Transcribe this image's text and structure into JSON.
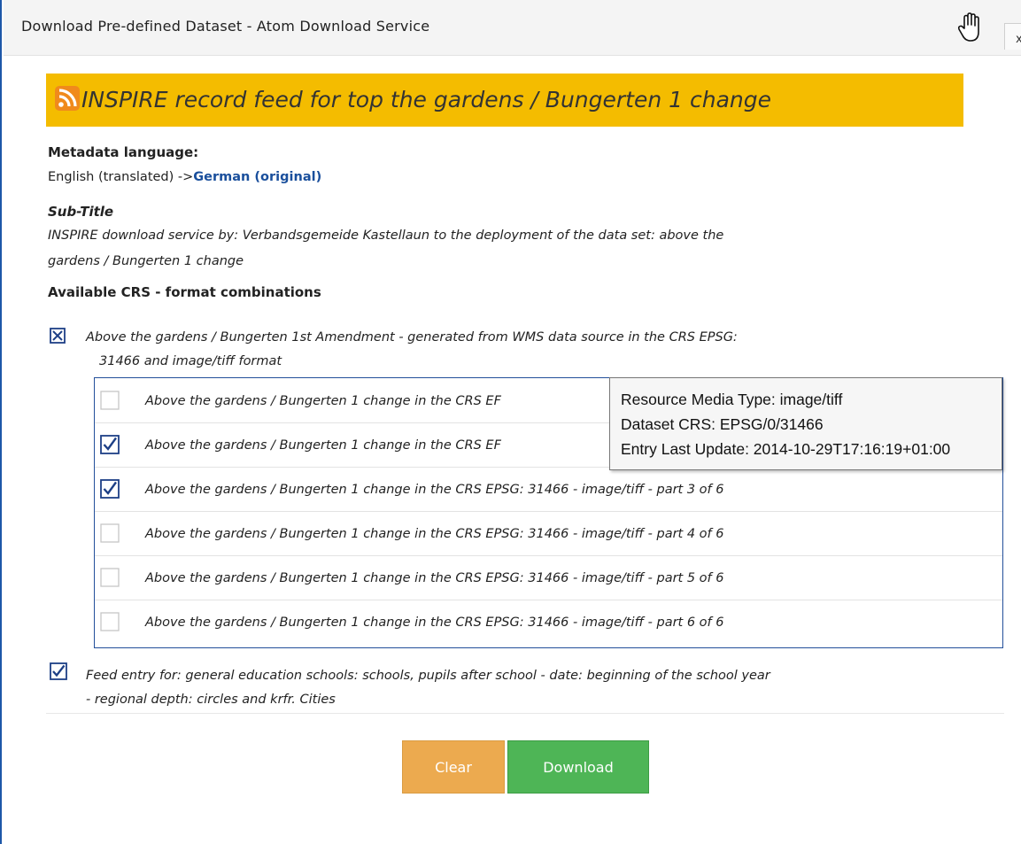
{
  "dialog": {
    "title": "Download Pre-defined Dataset - Atom Download Service",
    "close_label": "x"
  },
  "header": {
    "title": "INSPIRE record feed for top the gardens / Bungerten 1 change",
    "accent_color": "#f4bc00"
  },
  "metadata": {
    "language_label": "Metadata language:",
    "language_current": "English (translated) ->",
    "language_link": "German (original)"
  },
  "subtitle": {
    "label": "Sub-Title",
    "line1": "INSPIRE download service by: Verbandsgemeide Kastellaun to the deployment of the data set: above the",
    "line2": "gardens / Bungerten 1 change"
  },
  "crs": {
    "label": "Available CRS - format combinations",
    "main_entry": {
      "line1": "Above the gardens / Bungerten 1st Amendment - generated from WMS data source in the CRS EPSG:",
      "line2": "31466 and image/tiff format",
      "state": "partial"
    },
    "parts": [
      {
        "label": "Above the gardens / Bungerten 1 change in the CRS EF",
        "checked": false
      },
      {
        "label": "Above the gardens / Bungerten 1 change in the CRS EF",
        "checked": true
      },
      {
        "label": "Above the gardens / Bungerten 1 change in the CRS EPSG: 31466 - image/tiff - part 3 of 6",
        "checked": true
      },
      {
        "label": "Above the gardens / Bungerten 1 change in the CRS EPSG: 31466 - image/tiff - part 4 of 6",
        "checked": false
      },
      {
        "label": "Above the gardens / Bungerten 1 change in the CRS EPSG: 31466 - image/tiff - part 5 of 6",
        "checked": false
      },
      {
        "label": "Above the gardens / Bungerten 1 change in the CRS EPSG: 31466 - image/tiff - part 6 of 6",
        "checked": false
      }
    ],
    "second_entry": {
      "line1": "Feed entry for: general education schools: schools, pupils after school - date: beginning of the school year",
      "line2": "- regional depth: circles and krfr. Cities",
      "checked": true
    }
  },
  "tooltip": {
    "media_type": "Resource Media Type: image/tiff",
    "dataset_crs": "Dataset CRS: EPSG/0/31466",
    "last_update": "Entry Last Update: 2014-10-29T17:16:19+01:00"
  },
  "buttons": {
    "clear": "Clear",
    "download": "Download",
    "clear_color": "#ecaa4f",
    "download_color": "#4eb556"
  },
  "icons": {
    "rss": "rss-icon",
    "hand": "hand-cursor-icon",
    "checkbox_checked": "checkbox-checked-icon",
    "checkbox_unchecked": "checkbox-unchecked-icon",
    "checkbox_partial": "checkbox-partial-icon"
  }
}
